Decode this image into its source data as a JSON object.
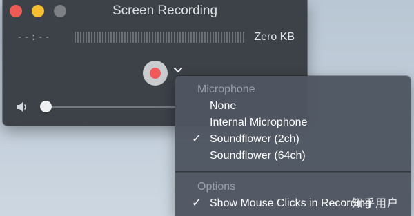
{
  "window": {
    "title": "Screen Recording",
    "time": "--:--",
    "size": "Zero KB"
  },
  "icons": {
    "close": "close-traffic-light",
    "minimize": "minimize-traffic-light",
    "zoom": "zoom-traffic-light",
    "record": "record-icon",
    "dropdown": "chevron-down-icon",
    "volume": "speaker-icon",
    "check": "checkmark-icon"
  },
  "volume": {
    "level": 0.0
  },
  "menu": {
    "microphone_header": "Microphone",
    "microphone_items": [
      {
        "label": "None",
        "checked": false
      },
      {
        "label": "Internal Microphone",
        "checked": false
      },
      {
        "label": "Soundflower (2ch)",
        "checked": true
      },
      {
        "label": "Soundflower (64ch)",
        "checked": false
      }
    ],
    "options_header": "Options",
    "options_items": [
      {
        "label": "Show Mouse Clicks in Recording",
        "checked": true
      }
    ],
    "check_glyph": "✓"
  },
  "watermark": "知乎用户",
  "colors": {
    "close": "#ee5b54",
    "minimize": "#f5bd2f",
    "zoom": "#7d8085",
    "record": "#f05a5a",
    "window_bg": "#3d4248",
    "menu_bg": "#4e5661"
  }
}
